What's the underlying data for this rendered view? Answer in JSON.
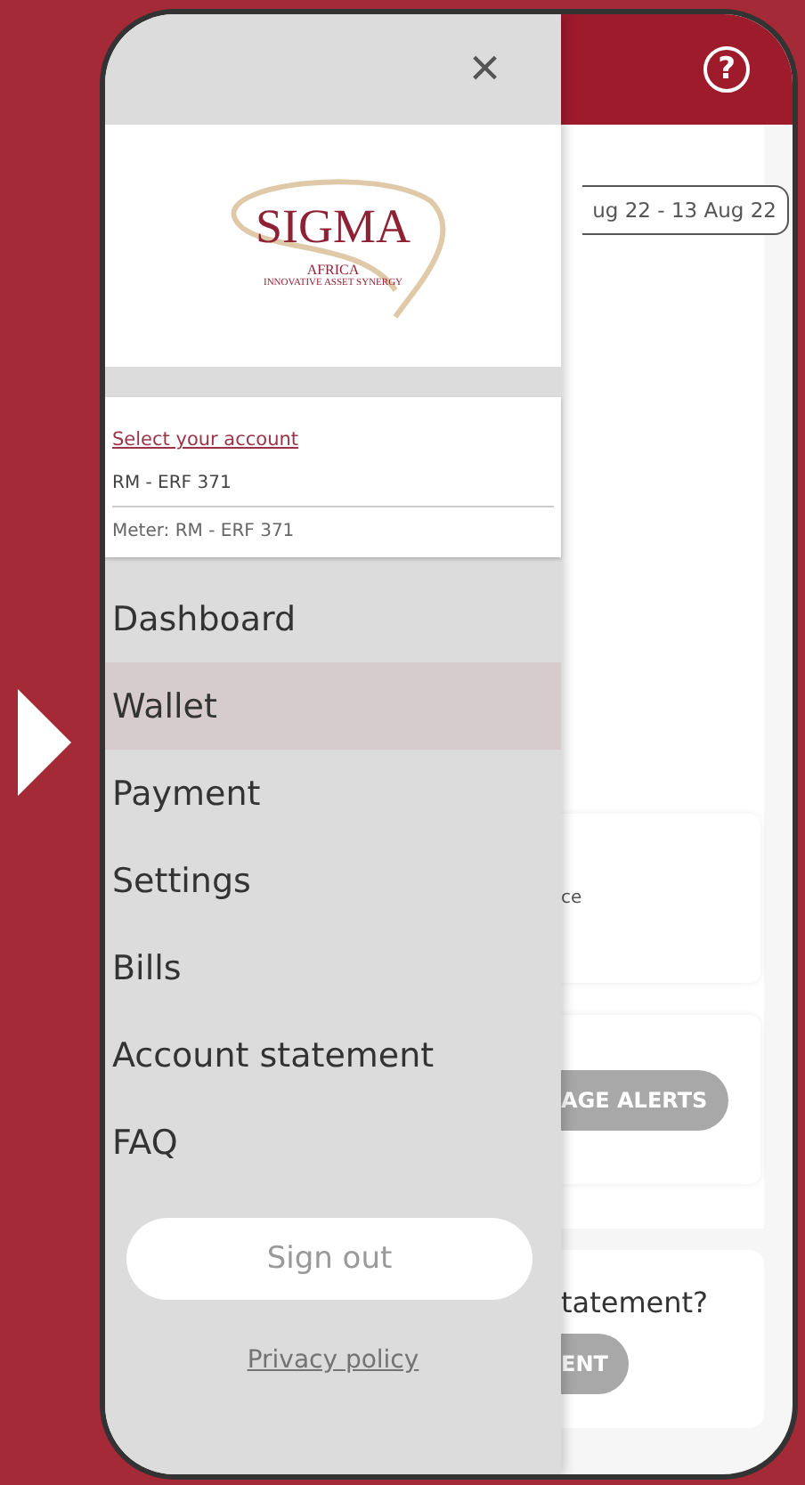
{
  "drawer": {
    "close": "×",
    "logo": {
      "name": "SIGMA",
      "region": "AFRICA",
      "tagline": "INNOVATIVE ASSET SYNERGY"
    },
    "account": {
      "link": "Select your account",
      "account": "RM - ERF 371",
      "meter": "Meter: RM - ERF 371"
    },
    "menu": [
      {
        "label": "Dashboard",
        "selected": false
      },
      {
        "label": "Wallet",
        "selected": true
      },
      {
        "label": "Payment",
        "selected": false
      },
      {
        "label": "Settings",
        "selected": false
      },
      {
        "label": "Bills",
        "selected": false
      },
      {
        "label": "Account statement",
        "selected": false
      },
      {
        "label": "FAQ",
        "selected": false
      }
    ],
    "sign_out": "Sign out",
    "privacy": "Privacy policy"
  },
  "background_app": {
    "header_help": "?",
    "date_range": "ug 22 - 13 Aug 22",
    "card_1_text": "ce",
    "card_2_button": "AGE ALERTS",
    "card_3_text": "tatement?",
    "card_3_button": "ENT"
  }
}
